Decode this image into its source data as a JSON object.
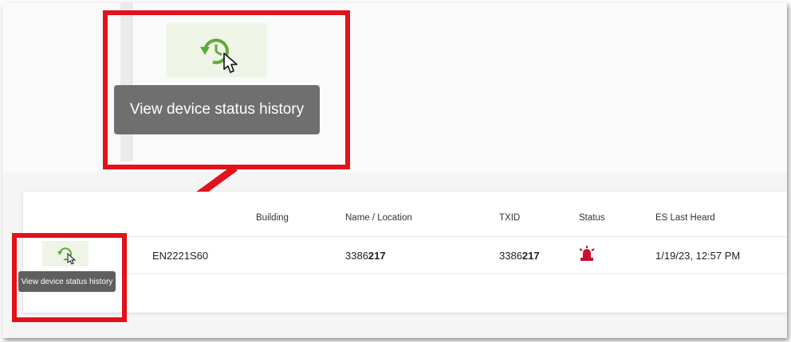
{
  "tooltip": {
    "text": "View device status history"
  },
  "table": {
    "headers": [
      "Building",
      "Name / Location",
      "TXID",
      "Status",
      "ES Last Heard"
    ],
    "row": {
      "device_id": "EN2221S60",
      "name_prefix": "3386",
      "name_bold": "217",
      "txid_prefix": "3386",
      "txid_bold": "217",
      "status_icon": "alarm-siren-icon",
      "last_heard": "1/19/23, 12:57 PM"
    }
  },
  "colors": {
    "callout_red": "#e3111b",
    "icon_green": "#5fa83a",
    "status_red": "#c8102e"
  }
}
